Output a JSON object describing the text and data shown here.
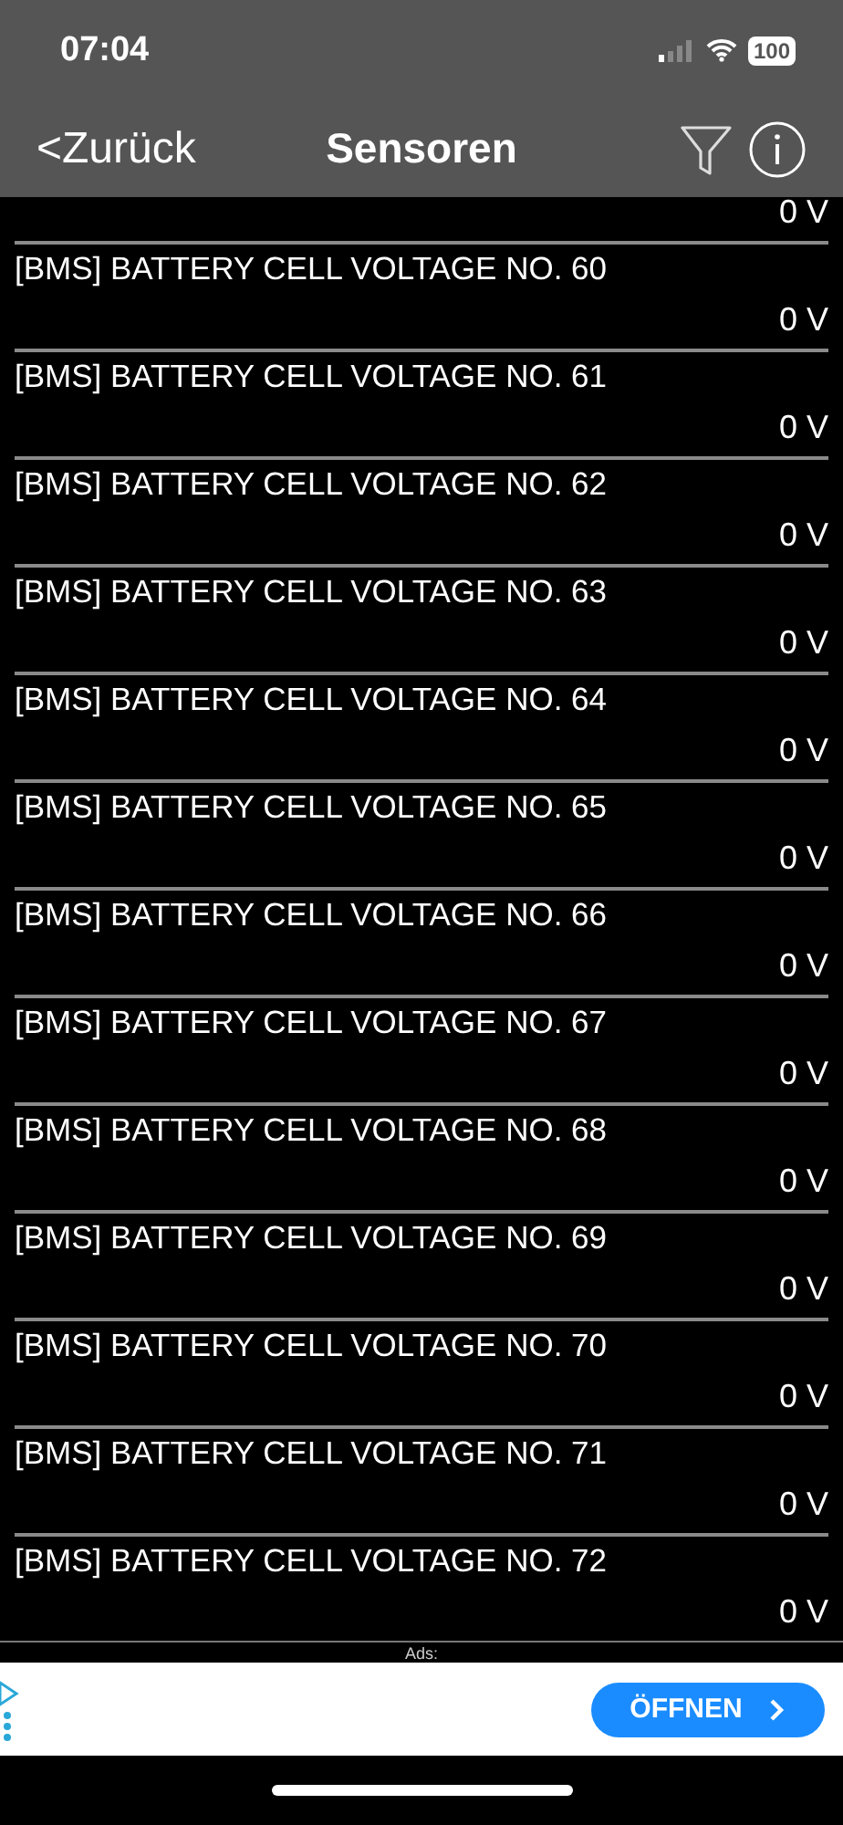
{
  "status_bar": {
    "time": "07:04",
    "battery": "100"
  },
  "nav_bar": {
    "back": "<Zurück",
    "title": "Sensoren"
  },
  "sensors": [
    {
      "value": "0 V"
    },
    {
      "name": "[BMS] BATTERY CELL VOLTAGE NO. 60",
      "value": "0 V"
    },
    {
      "name": "[BMS] BATTERY CELL VOLTAGE NO. 61",
      "value": "0 V"
    },
    {
      "name": "[BMS] BATTERY CELL VOLTAGE NO. 62",
      "value": "0 V"
    },
    {
      "name": "[BMS] BATTERY CELL VOLTAGE NO. 63",
      "value": "0 V"
    },
    {
      "name": "[BMS] BATTERY CELL VOLTAGE NO. 64",
      "value": "0 V"
    },
    {
      "name": "[BMS] BATTERY CELL VOLTAGE NO. 65",
      "value": "0 V"
    },
    {
      "name": "[BMS] BATTERY CELL VOLTAGE NO. 66",
      "value": "0 V"
    },
    {
      "name": "[BMS] BATTERY CELL VOLTAGE NO. 67",
      "value": "0 V"
    },
    {
      "name": "[BMS] BATTERY CELL VOLTAGE NO. 68",
      "value": "0 V"
    },
    {
      "name": "[BMS] BATTERY CELL VOLTAGE NO. 69",
      "value": "0 V"
    },
    {
      "name": "[BMS] BATTERY CELL VOLTAGE NO. 70",
      "value": "0 V"
    },
    {
      "name": "[BMS] BATTERY CELL VOLTAGE NO. 71",
      "value": "0 V"
    },
    {
      "name": "[BMS] BATTERY CELL VOLTAGE NO. 72",
      "value": "0 V"
    }
  ],
  "ad": {
    "label": "Ads:",
    "button": "ÖFFNEN"
  }
}
